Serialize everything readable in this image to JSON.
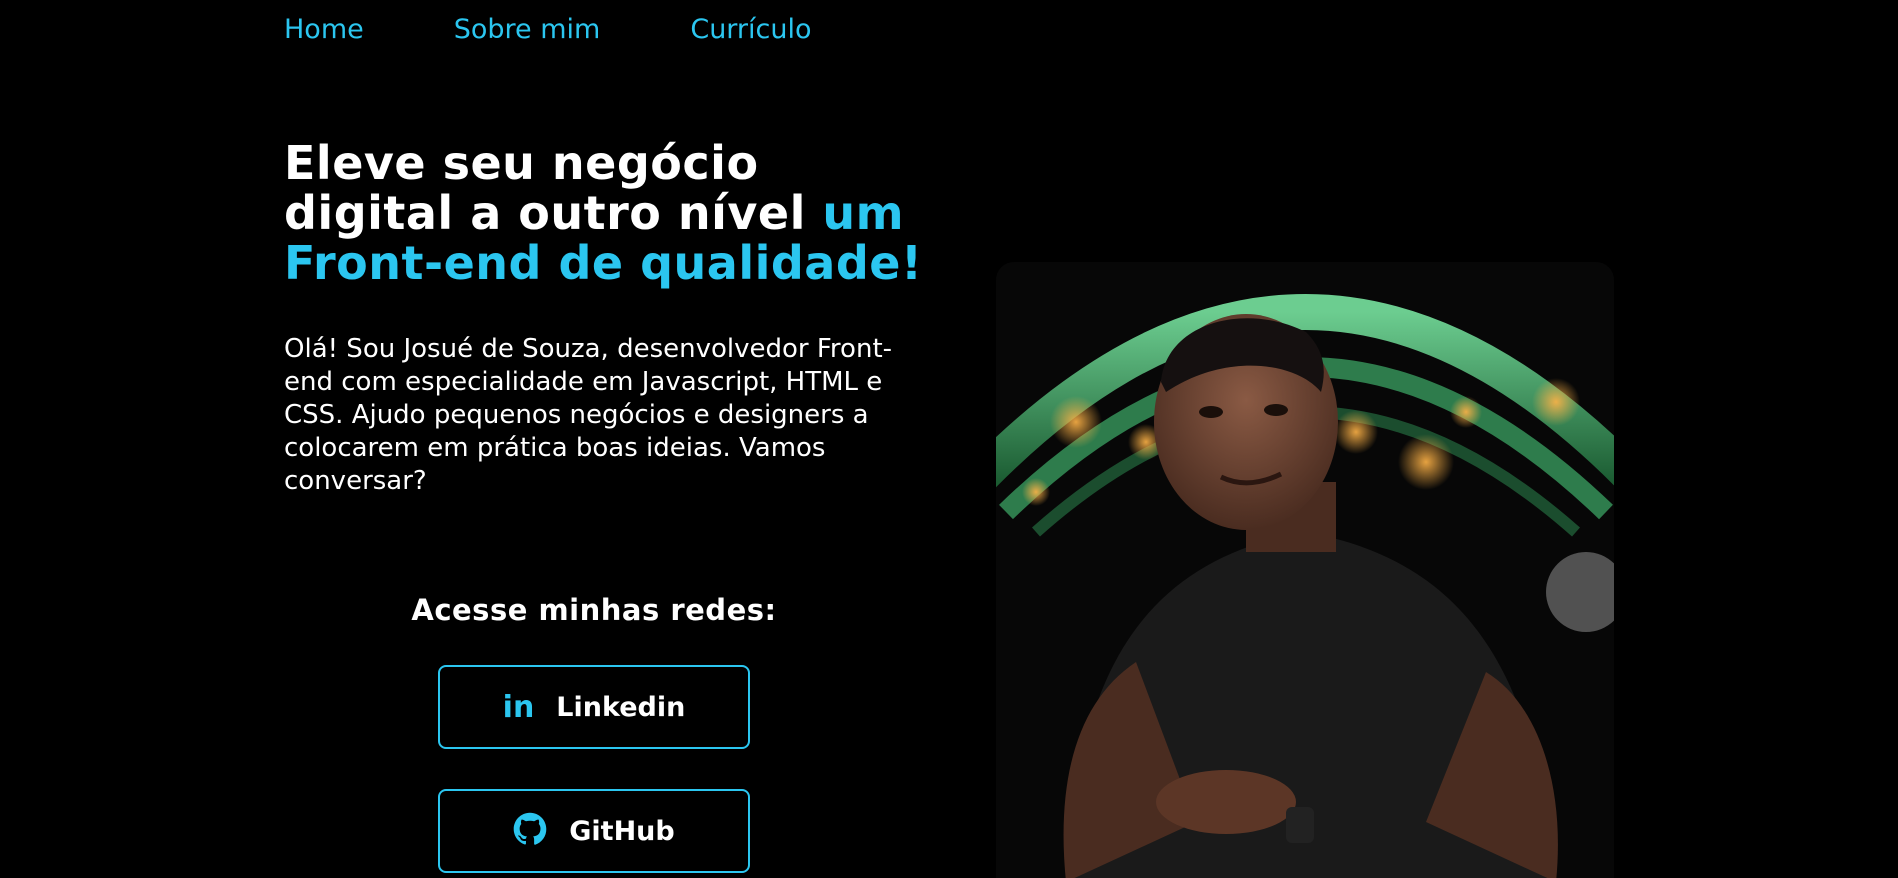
{
  "nav": {
    "items": [
      {
        "label": "Home"
      },
      {
        "label": "Sobre mim"
      },
      {
        "label": "Currículo"
      }
    ]
  },
  "hero": {
    "headline_white": "Eleve seu negócio digital a outro nível",
    "headline_accent": "um Front-end de qualidade!",
    "intro": "Olá! Sou Josué de Souza, desenvolvedor Front-end com especialidade em Javascript, HTML e CSS. Ajudo pequenos negócios e designers a colocarem em prática boas ideias. Vamos conversar?"
  },
  "socials": {
    "title": "Acesse minhas redes:",
    "linkedin": {
      "label": "Linkedin",
      "icon": "linkedin-icon"
    },
    "github": {
      "label": "GitHub",
      "icon": "github-icon"
    }
  },
  "colors": {
    "background": "#000000",
    "accent": "#2bc6f0",
    "text": "#ffffff"
  }
}
